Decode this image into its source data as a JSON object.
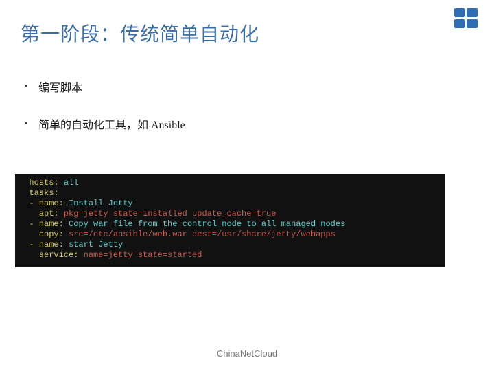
{
  "title": "第一阶段：传统简单自动化",
  "bullets": [
    "编写脚本",
    "简单的自动化工具，如 Ansible"
  ],
  "code": {
    "lines": [
      [
        {
          "c": "yellow",
          "t": "  hosts: "
        },
        {
          "c": "cyan",
          "t": "all"
        }
      ],
      [
        {
          "c": "yellow",
          "t": "  tasks:"
        }
      ],
      [
        {
          "c": "yellow",
          "t": "  - name: "
        },
        {
          "c": "cyan",
          "t": "Install Jetty"
        }
      ],
      [
        {
          "c": "yellow",
          "t": "    apt: "
        },
        {
          "c": "red",
          "t": "pkg=jetty state=installed update_cache=true"
        }
      ],
      [
        {
          "c": "yellow",
          "t": "  - name: "
        },
        {
          "c": "cyan",
          "t": "Copy war file from the control node to all managed nodes"
        }
      ],
      [
        {
          "c": "yellow",
          "t": "    copy: "
        },
        {
          "c": "red",
          "t": "src=/etc/ansible/web.war dest=/usr/share/jetty/webapps"
        }
      ],
      [
        {
          "c": "yellow",
          "t": "  - name: "
        },
        {
          "c": "cyan",
          "t": "start Jetty"
        }
      ],
      [
        {
          "c": "yellow",
          "t": "    service: "
        },
        {
          "c": "red",
          "t": "name=jetty state=started"
        }
      ]
    ]
  },
  "footer": "ChinaNetCloud"
}
